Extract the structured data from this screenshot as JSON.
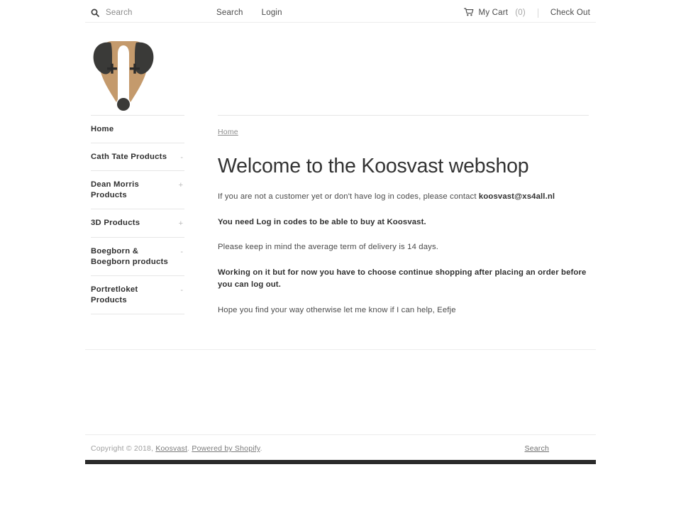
{
  "header": {
    "search": {
      "icon": "search-icon",
      "placeholder": "Search",
      "value": ""
    },
    "nav_links": [
      {
        "label": "Search"
      },
      {
        "label": "Login"
      }
    ],
    "cart": {
      "icon": "shopping-cart-icon",
      "label": "My Cart",
      "count": "(0)"
    },
    "checkout_label": "Check Out"
  },
  "logo": {
    "name": "koosvast-dog-logo",
    "face_color": "#c49a6c",
    "ear_color": "#3a3a38",
    "nose_color": "#3a3a38"
  },
  "sidebar": {
    "items": [
      {
        "label": "Home",
        "toggle": ""
      },
      {
        "label": "Cath Tate Products",
        "toggle": "-"
      },
      {
        "label": "Dean Morris Products",
        "toggle": "+"
      },
      {
        "label": "3D Products",
        "toggle": "+"
      },
      {
        "label": "Boegborn & Boegborn products",
        "toggle": "-"
      },
      {
        "label": "Portretloket Products",
        "toggle": "-"
      }
    ]
  },
  "main": {
    "breadcrumb": "Home",
    "title": "Welcome to the Koosvast webshop",
    "paragraph_1_pre": "If you are not a customer yet or don't have log in codes, please contact ",
    "paragraph_1_email": "koosvast@xs4all.nl",
    "paragraph_2": "You need Log in codes to be able to buy at Koosvast.",
    "paragraph_3": "Please keep in mind the average term of delivery is 14 days.",
    "paragraph_4": "Working on it but for now you have to choose continue shopping after placing an order before you can log out.",
    "paragraph_5": "Hope you find your way otherwise let me know if I can help, Eefje"
  },
  "footer": {
    "copyright_prefix": "Copyright © 2018, ",
    "shop_link": "Koosvast",
    "separator": ". ",
    "powered_by": "Powered by Shopify",
    "suffix": ".",
    "search_link": "Search"
  }
}
